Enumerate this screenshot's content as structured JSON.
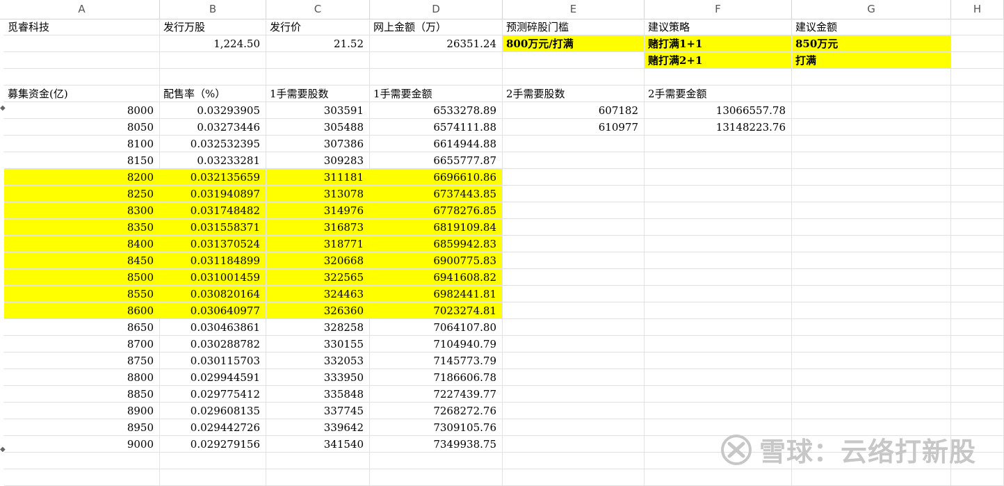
{
  "column_headers": [
    "A",
    "B",
    "C",
    "D",
    "E",
    "F",
    "G",
    "H"
  ],
  "rows": [
    [
      "觅睿科技",
      "发行万股",
      "发行价",
      "网上金额（万）",
      "预测碎股门槛",
      "建议策略",
      "建议金额",
      ""
    ],
    [
      "",
      "1,224.50",
      "21.52",
      "26351.24",
      "800万元/打满",
      "赌打满1+1",
      "850万元",
      ""
    ],
    [
      "",
      "",
      "",
      "",
      "",
      "赌打满2+1",
      "打满",
      ""
    ],
    [
      "",
      "",
      "",
      "",
      "",
      "",
      "",
      ""
    ],
    [
      "募集资金(亿)",
      "配售率（%）",
      "1手需要股数",
      "1手需要金额",
      "2手需要股数",
      "2手需要金额",
      "",
      ""
    ],
    [
      "8000",
      "0.03293905",
      "303591",
      "6533278.89",
      "607182",
      "13066557.78",
      "",
      ""
    ],
    [
      "8050",
      "0.03273446",
      "305488",
      "6574111.88",
      "610977",
      "13148223.76",
      "",
      ""
    ],
    [
      "8100",
      "0.032532395",
      "307386",
      "6614944.88",
      "",
      "",
      "",
      ""
    ],
    [
      "8150",
      "0.03233281",
      "309283",
      "6655777.87",
      "",
      "",
      "",
      ""
    ],
    [
      "8200",
      "0.032135659",
      "311181",
      "6696610.86",
      "",
      "",
      "",
      ""
    ],
    [
      "8250",
      "0.031940897",
      "313078",
      "6737443.85",
      "",
      "",
      "",
      ""
    ],
    [
      "8300",
      "0.031748482",
      "314976",
      "6778276.85",
      "",
      "",
      "",
      ""
    ],
    [
      "8350",
      "0.031558371",
      "316873",
      "6819109.84",
      "",
      "",
      "",
      ""
    ],
    [
      "8400",
      "0.031370524",
      "318771",
      "6859942.83",
      "",
      "",
      "",
      ""
    ],
    [
      "8450",
      "0.031184899",
      "320668",
      "6900775.83",
      "",
      "",
      "",
      ""
    ],
    [
      "8500",
      "0.031001459",
      "322565",
      "6941608.82",
      "",
      "",
      "",
      ""
    ],
    [
      "8550",
      "0.030820164",
      "324463",
      "6982441.81",
      "",
      "",
      "",
      ""
    ],
    [
      "8600",
      "0.030640977",
      "326360",
      "7023274.81",
      "",
      "",
      "",
      ""
    ],
    [
      "8650",
      "0.030463861",
      "328258",
      "7064107.80",
      "",
      "",
      "",
      ""
    ],
    [
      "8700",
      "0.030288782",
      "330155",
      "7104940.79",
      "",
      "",
      "",
      ""
    ],
    [
      "8750",
      "0.030115703",
      "332053",
      "7145773.79",
      "",
      "",
      "",
      ""
    ],
    [
      "8800",
      "0.029944591",
      "333950",
      "7186606.78",
      "",
      "",
      "",
      ""
    ],
    [
      "8850",
      "0.029775412",
      "335848",
      "7227439.77",
      "",
      "",
      "",
      ""
    ],
    [
      "8900",
      "0.029608135",
      "337745",
      "7268272.76",
      "",
      "",
      "",
      ""
    ],
    [
      "8950",
      "0.029442726",
      "339642",
      "7309105.76",
      "",
      "",
      "",
      ""
    ],
    [
      "9000",
      "0.029279156",
      "341540",
      "7349938.75",
      "",
      "",
      "",
      ""
    ],
    [
      "",
      "",
      "",
      "",
      "",
      "",
      "",
      ""
    ],
    [
      "",
      "",
      "",
      "",
      "",
      "",
      "",
      ""
    ]
  ],
  "highlight_color": "#ffff00",
  "watermark": {
    "text": "雪球：云络打新股",
    "icon": "xueqiu-logo-icon"
  }
}
